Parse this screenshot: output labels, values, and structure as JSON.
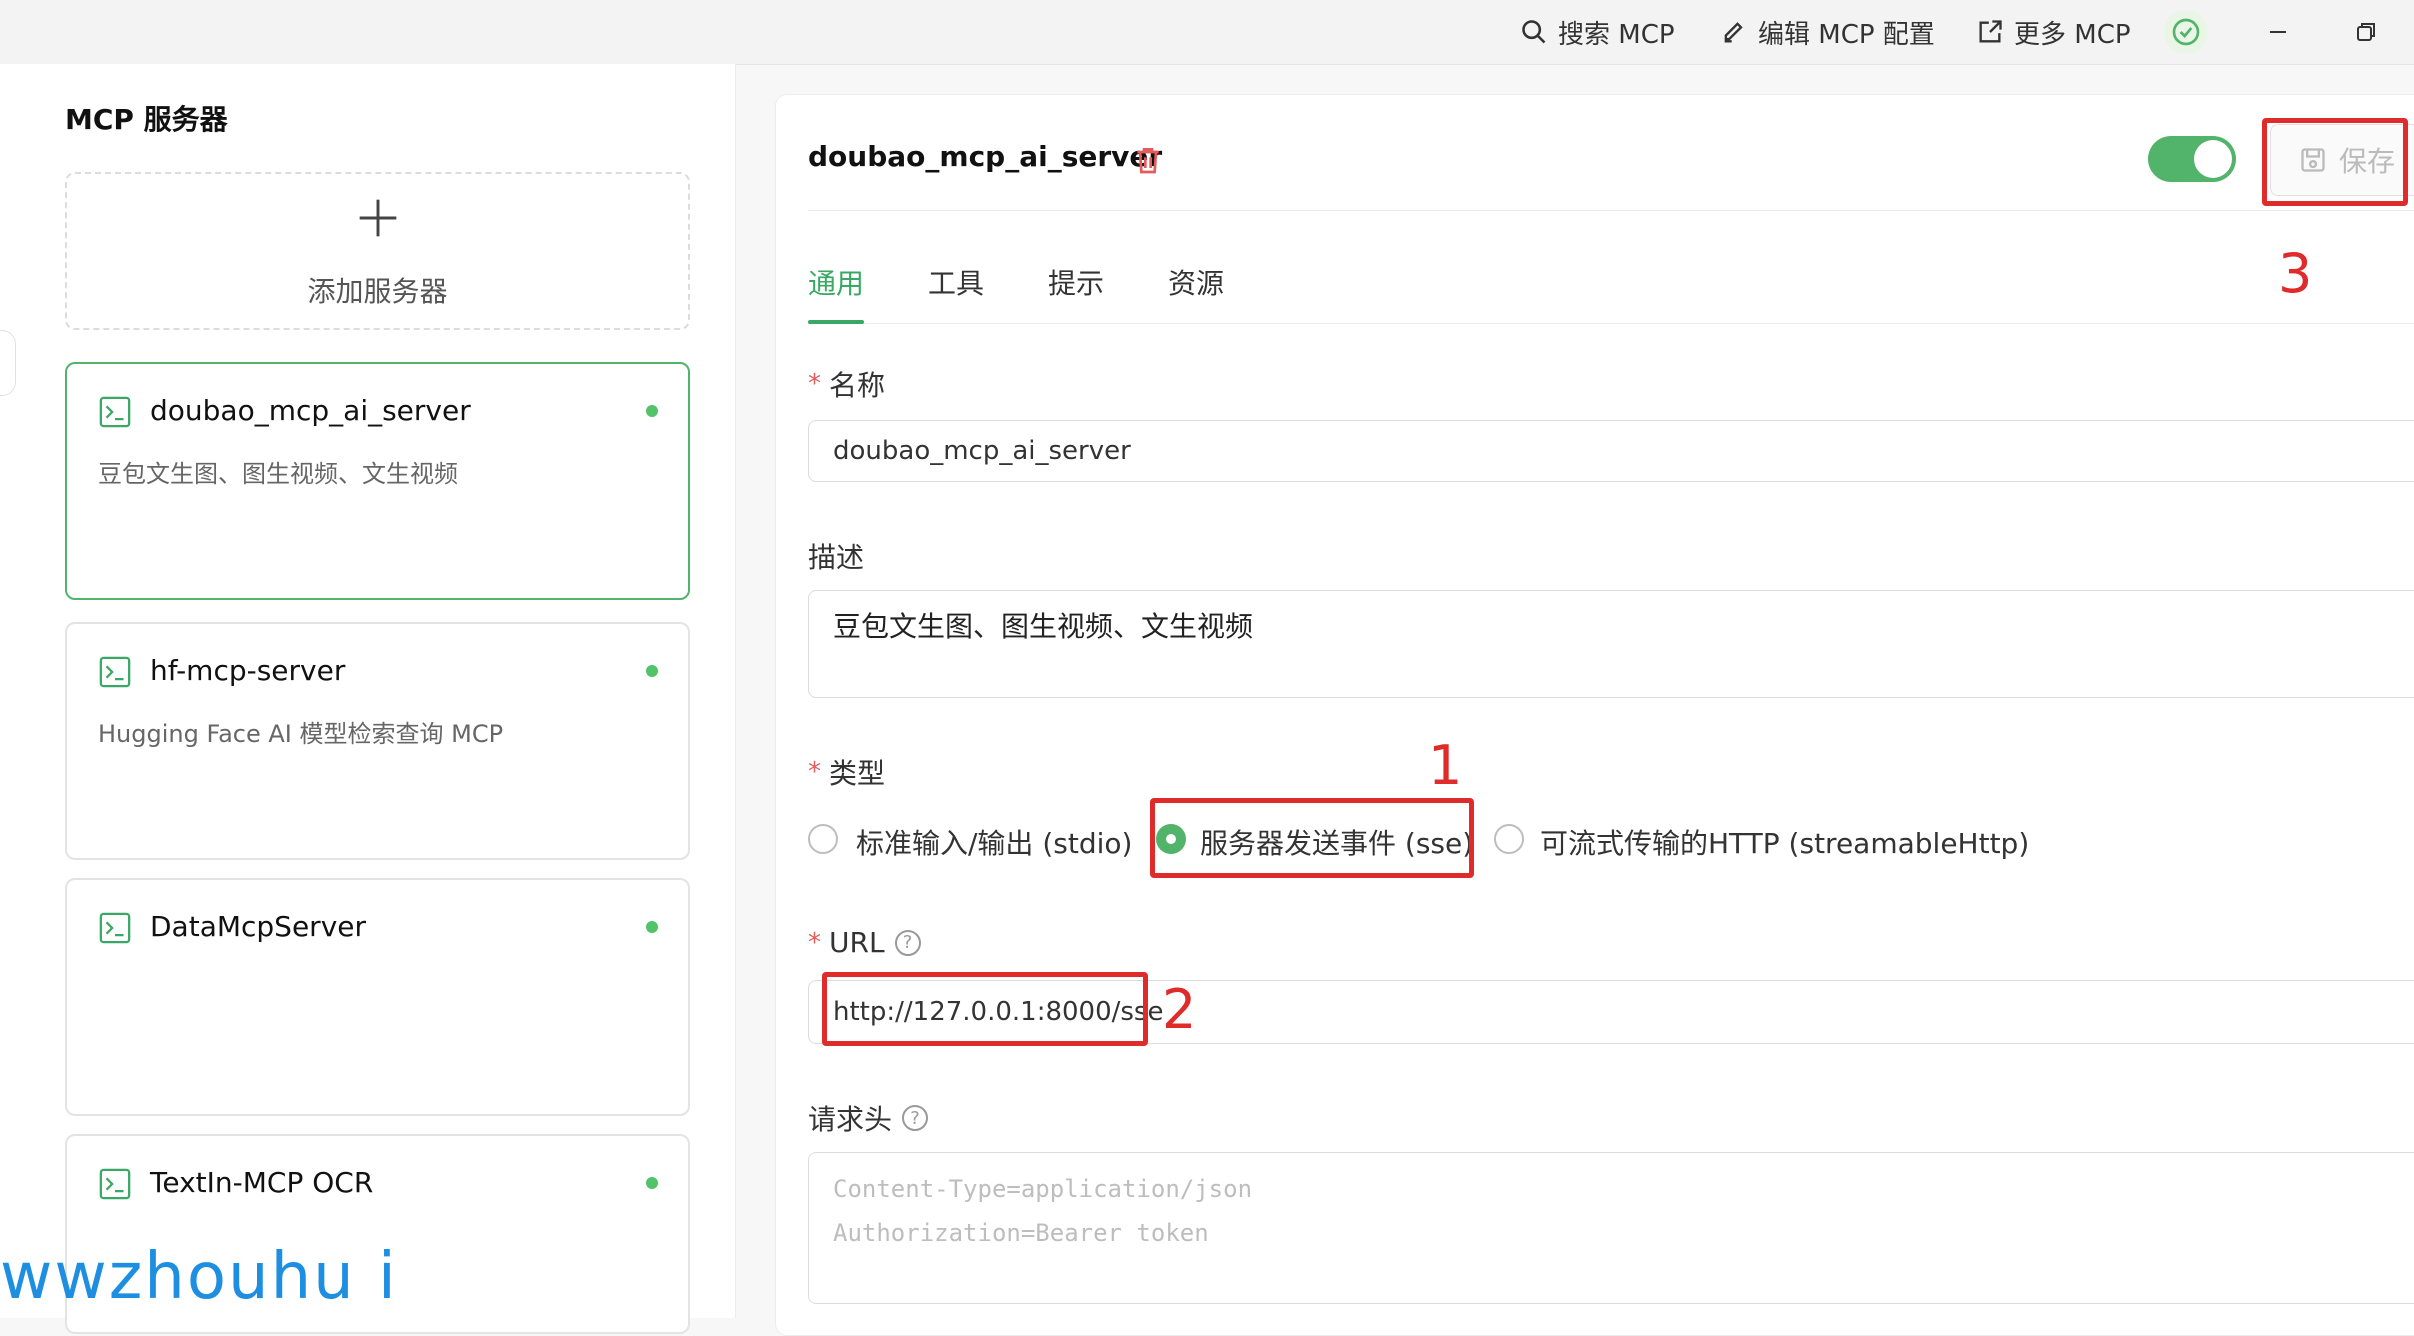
{
  "topbar": {
    "search_label": "搜索 MCP",
    "edit_label": "编辑 MCP 配置",
    "more_label": "更多 MCP"
  },
  "sidebar": {
    "title": "MCP 服务器",
    "add_label": "添加服务器",
    "servers": [
      {
        "name": "doubao_mcp_ai_server",
        "desc": "豆包文生图、图生视频、文生视频",
        "active": true
      },
      {
        "name": "hf-mcp-server",
        "desc": "Hugging Face AI 模型检索查询 MCP",
        "active": false
      },
      {
        "name": "DataMcpServer",
        "desc": "",
        "active": false
      },
      {
        "name": "TextIn-MCP OCR",
        "desc": "",
        "active": false
      }
    ]
  },
  "watermark": "wwzhouhu i",
  "detail": {
    "title": "doubao_mcp_ai_server",
    "save_label": "保存",
    "enabled": true,
    "tabs": [
      "通用",
      "工具",
      "提示",
      "资源"
    ],
    "active_tab": 0,
    "fields": {
      "name_label": "名称",
      "name_value": "doubao_mcp_ai_server",
      "desc_label": "描述",
      "desc_value": "豆包文生图、图生视频、文生视频",
      "type_label": "类型",
      "type_options": [
        "标准输入/输出 (stdio)",
        "服务器发送事件 (sse)",
        "可流式传输的HTTP (streamableHttp)"
      ],
      "type_selected": 1,
      "url_label": "URL",
      "url_value": "http://127.0.0.1:8000/sse",
      "headers_label": "请求头",
      "headers_placeholder_1": "Content-Type=application/json",
      "headers_placeholder_2": "Authorization=Bearer token"
    }
  },
  "annotations": [
    "1",
    "2",
    "3"
  ],
  "colors": {
    "accent": "#52b36a",
    "tab_active": "#3aa865",
    "annotation": "#e02b2b",
    "watermark": "#1e8fe0"
  }
}
